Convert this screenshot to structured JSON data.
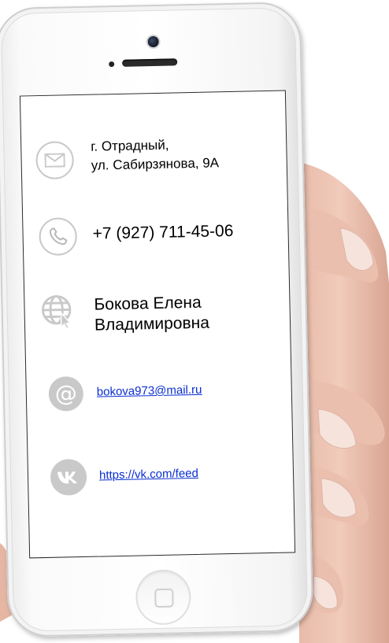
{
  "contacts": {
    "address_line1": "г. Отрадный,",
    "address_line2": "ул. Сабирзянова, 9А",
    "phone": "+7 (927) 711-45-06",
    "name_line1": "Бокова Елена",
    "name_line2": "Владимировна",
    "email": "bokova973@mail.ru",
    "vk_link": "https://vk.com/feed"
  },
  "icons": {
    "address": "envelope-icon",
    "phone": "phone-icon",
    "name": "globe-cursor-icon",
    "email": "at-sign-icon",
    "vk": "vk-logo-icon"
  },
  "colors": {
    "icon_gray": "#c9c9c9",
    "link_blue": "#0a2fd1",
    "text": "#000000"
  }
}
